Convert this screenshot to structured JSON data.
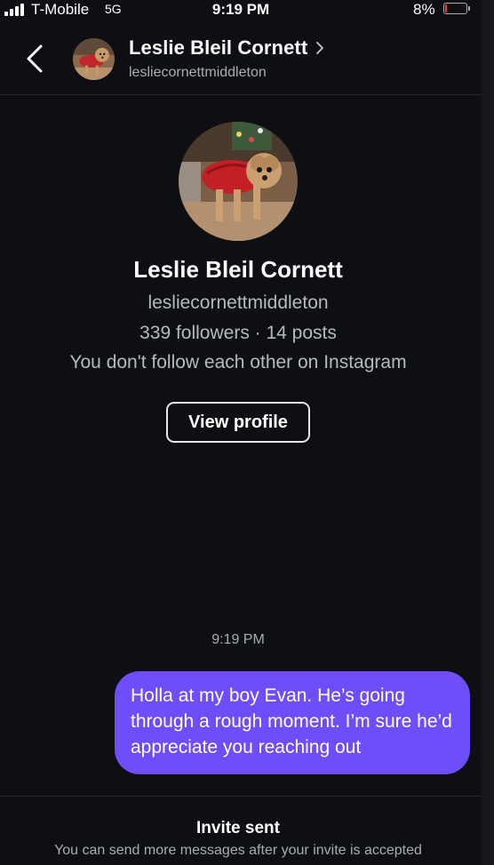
{
  "status_bar": {
    "carrier": "T-Mobile",
    "network": "5G",
    "time": "9:19 PM",
    "battery_percent": "8%",
    "battery_level": 0.08,
    "battery_color": "#ff3b30"
  },
  "header": {
    "back_icon": "chevron-left-icon",
    "name": "Leslie Bleil Cornett",
    "username": "lesliecornettmiddleton",
    "chevron_icon": "chevron-right-icon"
  },
  "profile": {
    "name": "Leslie Bleil Cornett",
    "username": "lesliecornettmiddleton",
    "stats": "339 followers · 14 posts",
    "follow_note": "You don't follow each other on Instagram",
    "view_profile_label": "View profile"
  },
  "conversation": {
    "timestamp": "9:19 PM",
    "messages": [
      {
        "sender": "me",
        "text": "Holla at my boy Evan. He’s going through a rough moment. I’m sure he’d appreciate you reaching out",
        "bubble_color": "#6f4dfa"
      }
    ]
  },
  "footer": {
    "title": "Invite sent",
    "note": "You can send more messages after your invite is accepted"
  }
}
